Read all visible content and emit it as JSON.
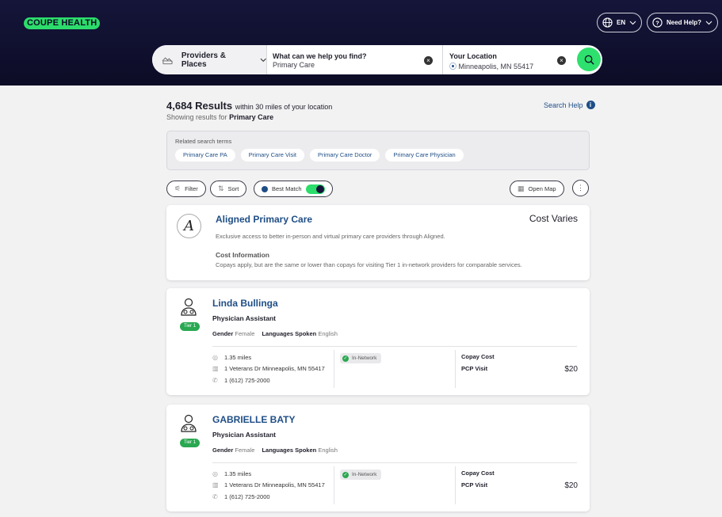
{
  "header": {
    "logo": "COUPE HEALTH",
    "language": "EN",
    "help": "Need Help?"
  },
  "search": {
    "category": "Providers & Places",
    "find_label": "What can we help you find?",
    "find_value": "Primary Care",
    "location_label": "Your Location",
    "location_value": "Minneapolis, MN 55417"
  },
  "results": {
    "count": "4,684 Results",
    "suffix": "within 30 miles of your location",
    "showing_prefix": "Showing results for",
    "showing_term": "Primary Care",
    "search_help": "Search Help"
  },
  "related": {
    "label": "Related search terms",
    "terms": [
      "Primary Care PA",
      "Primary Care Visit",
      "Primary Care Doctor",
      "Primary Care Physician"
    ]
  },
  "controls": {
    "filter": "Filter",
    "sort": "Sort",
    "best_match": "Best Match",
    "open_map": "Open Map"
  },
  "aligned": {
    "name": "Aligned Primary Care",
    "cost": "Cost Varies",
    "description": "Exclusive access to better in-person and virtual primary care providers through Aligned.",
    "cost_heading": "Cost Information",
    "cost_info": "Copays apply, but are the same or lower than copays for visiting Tier 1 in-network providers for comparable services."
  },
  "providers": [
    {
      "name": "Linda Bullinga",
      "title": "Physician Assistant",
      "tier": "Tier 1",
      "gender_label": "Gender",
      "gender": "Female",
      "languages_label": "Languages Spoken",
      "languages": "English",
      "distance": "1.35 miles",
      "address": "1 Veterans Dr Minneapolis, MN 55417",
      "phone": "1 (612) 725-2000",
      "network": "In-Network",
      "copay_heading": "Copay Cost",
      "copay_label": "PCP Visit",
      "copay_value": "$20"
    },
    {
      "name": "GABRIELLE BATY",
      "title": "Physician Assistant",
      "tier": "Tier 1",
      "gender_label": "Gender",
      "gender": "Female",
      "languages_label": "Languages Spoken",
      "languages": "English",
      "distance": "1.35 miles",
      "address": "1 Veterans Dr Minneapolis, MN 55417",
      "phone": "1 (612) 725-2000",
      "network": "In-Network",
      "copay_heading": "Copay Cost",
      "copay_label": "PCP Visit",
      "copay_value": "$20"
    }
  ],
  "colors": {
    "brand_green": "#2cdd6b",
    "header_bg": "#15153a",
    "link_blue": "#1f4e86",
    "tier_green": "#2aa851"
  }
}
